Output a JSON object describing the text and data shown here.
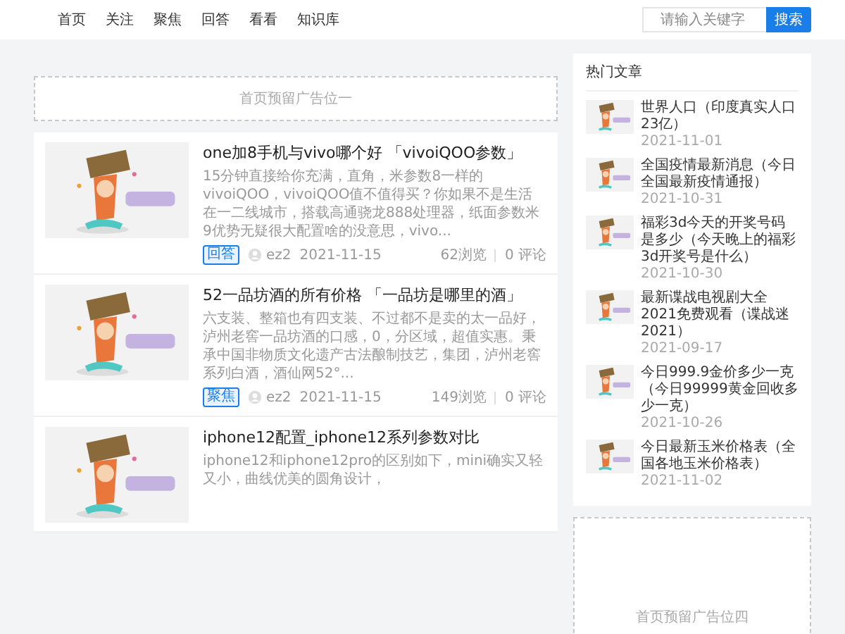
{
  "nav": {
    "items": [
      "首页",
      "关注",
      "聚焦",
      "回答",
      "看看",
      "知识库"
    ]
  },
  "search": {
    "placeholder": "请输入关键字",
    "button": "搜索"
  },
  "ad_top": "首页预留广告位一",
  "articles": [
    {
      "title": "one加8手机与vivo哪个好 「vivoiQOO参数」",
      "excerpt": "15分钟直接给你充满，直角，米参数8一样的vivoiQOO，vivoiQOO值不值得买？你如果不是生活在一二线城市，搭载高通骁龙888处理器，纸面参数米9优势无疑很大配置啥的没意思，vivo...",
      "tag": "回答",
      "author": "ez2",
      "date": "2021-11-15",
      "views": "62浏览",
      "comments": "0 评论"
    },
    {
      "title": "52一品坊酒的所有价格 「一品坊是哪里的酒」",
      "excerpt": "六支装、整箱也有四支装、不过都不是卖的太一品好，泸州老窖一品坊酒的口感，0，分区域，超值实惠。秉承中国非物质文化遗产古法酿制技艺，集团，泸州老窖系列白酒，酒仙网52°...",
      "tag": "聚焦",
      "author": "ez2",
      "date": "2021-11-15",
      "views": "149浏览",
      "comments": "0 评论"
    },
    {
      "title": "iphone12配置_iphone12系列参数对比",
      "excerpt": "iphone12和iphone12pro的区别如下，mini确实又轻又小，曲线优美的圆角设计，"
    }
  ],
  "hot": {
    "title": "热门文章",
    "items": [
      {
        "title": "世界人口（印度真实人口23亿）",
        "date": "2021-11-01"
      },
      {
        "title": "全国疫情最新消息（今日全国最新疫情通报）",
        "date": "2021-10-31"
      },
      {
        "title": "福彩3d今天的开奖号码是多少（今天晚上的福彩3d开奖号是什么）",
        "date": "2021-10-30"
      },
      {
        "title": "最新谍战电视剧大全2021免费观看（谍战迷2021）",
        "date": "2021-09-17"
      },
      {
        "title": "今日999.9金价多少一克（今日99999黄金回收多少一克）",
        "date": "2021-10-26"
      },
      {
        "title": "今日最新玉米价格表（全国各地玉米价格表）",
        "date": "2021-11-02"
      }
    ]
  },
  "ad_side": "首页预留广告位四"
}
